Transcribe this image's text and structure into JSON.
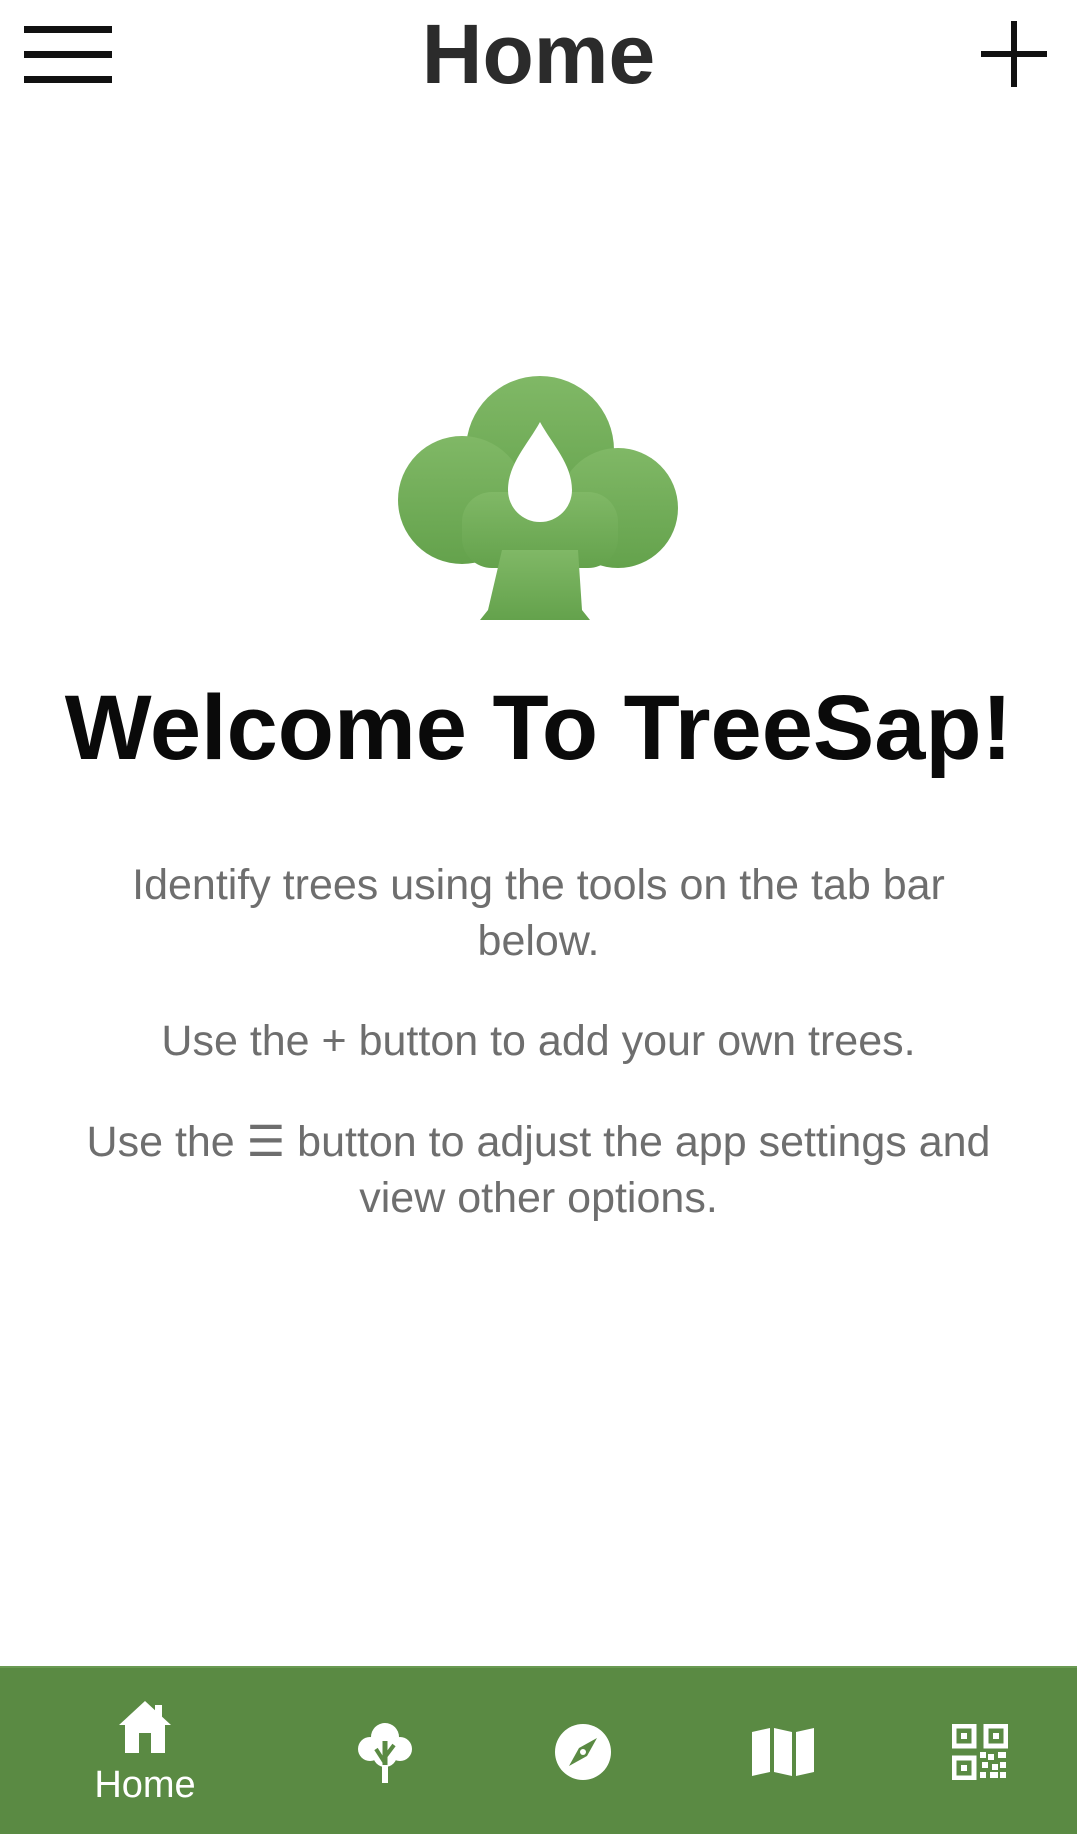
{
  "header": {
    "title": "Home",
    "menu_icon": "hamburger-menu-icon",
    "add_icon": "plus-icon"
  },
  "logo": {
    "icon": "tree-with-sap-drop-logo",
    "color": "#72ab58"
  },
  "welcome": {
    "title": "Welcome To TreeSap!",
    "paragraphs": [
      "Identify trees using the tools on the tab bar below.",
      "Use the + button to add your own trees.",
      "Use the ☰ button to adjust the app settings and view other options."
    ]
  },
  "tabbar": {
    "background": "#5a8a43",
    "tabs": [
      {
        "label": "Home",
        "icon": "home-icon",
        "active": true
      },
      {
        "label": "",
        "icon": "tree-icon"
      },
      {
        "label": "",
        "icon": "compass-icon"
      },
      {
        "label": "",
        "icon": "map-icon"
      },
      {
        "label": "",
        "icon": "qr-code-icon"
      }
    ]
  }
}
